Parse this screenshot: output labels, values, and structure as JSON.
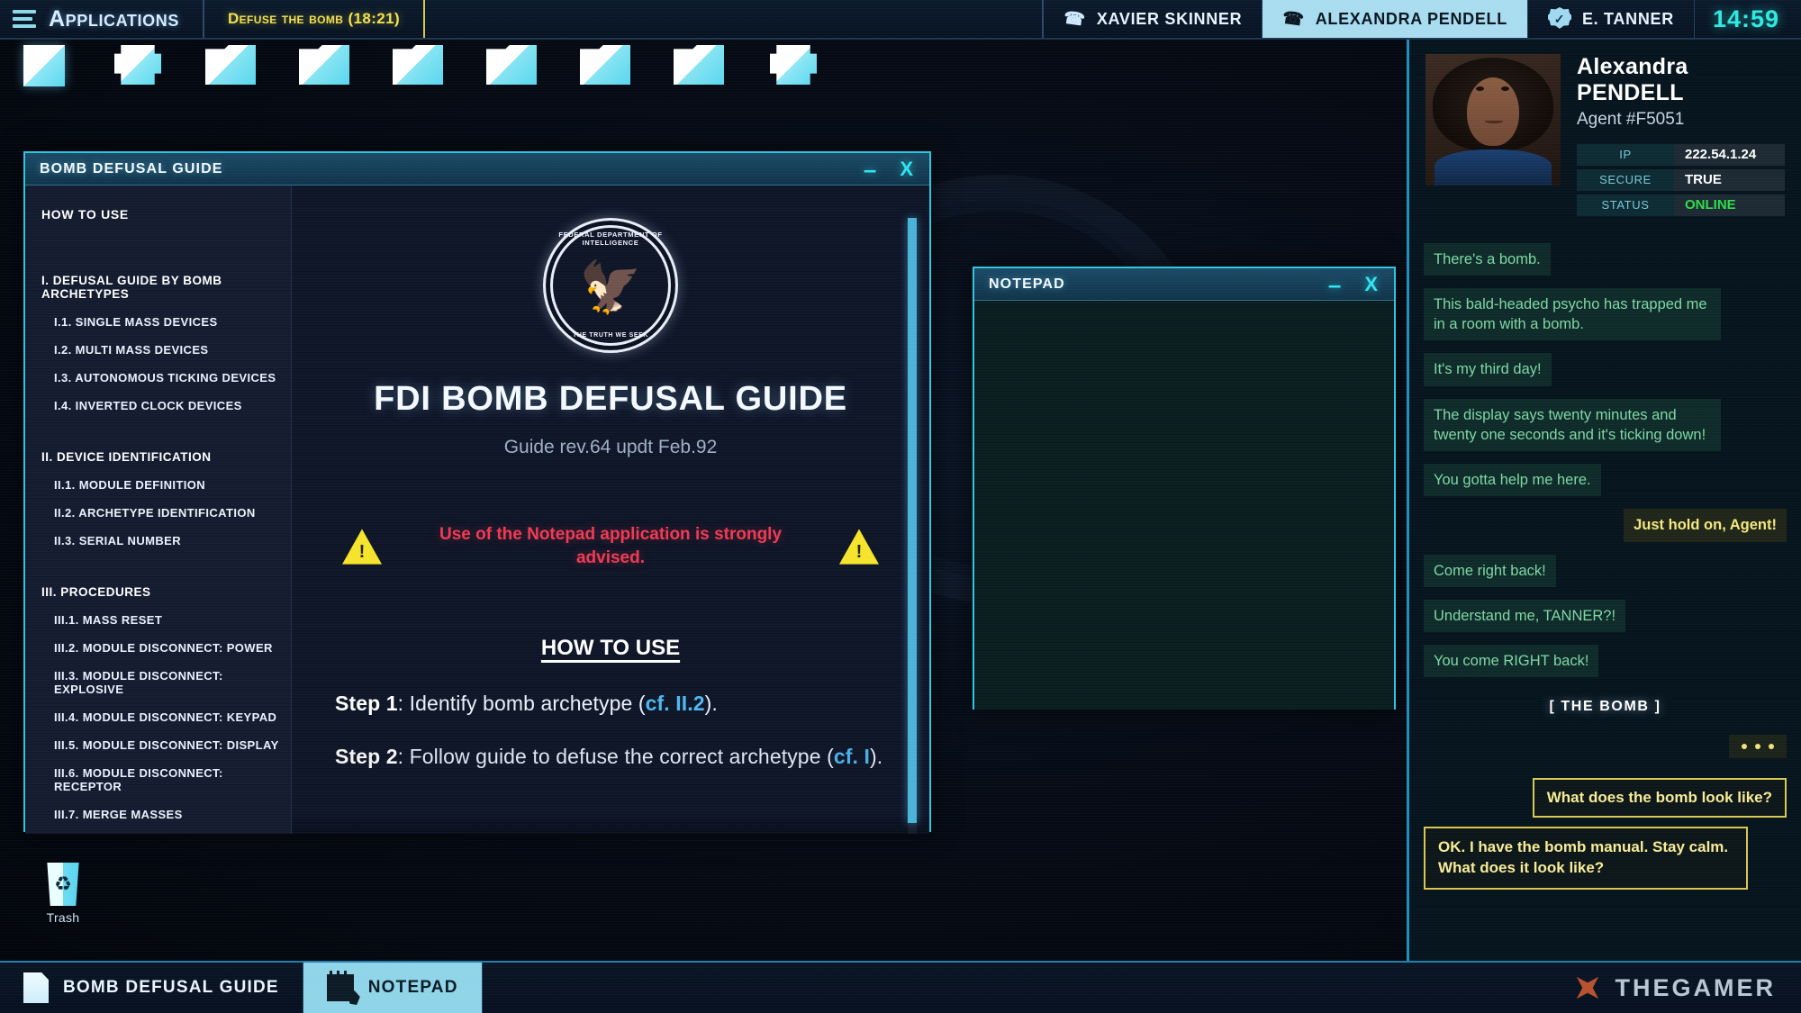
{
  "topbar": {
    "apps_label": "Applications",
    "apps_icon": "hamburger-menu-icon",
    "mission": "Defuse the bomb (18:21)",
    "contacts": [
      {
        "name": "XAVIER SKINNER",
        "icon": "phone-icon",
        "active": false
      },
      {
        "name": "ALEXANDRA PENDELL",
        "icon": "phone-icon",
        "active": true
      }
    ],
    "user": {
      "name": "E. TANNER",
      "icon": "badge-icon"
    },
    "clock": "14:59"
  },
  "desktop": {
    "icons": [
      {
        "name": "document-icon",
        "type": "doc"
      },
      {
        "name": "printer-icon",
        "type": "printer"
      },
      {
        "name": "folder-icon",
        "type": "folder"
      },
      {
        "name": "folder-icon",
        "type": "folder"
      },
      {
        "name": "folder-icon",
        "type": "folder"
      },
      {
        "name": "folder-icon",
        "type": "folder"
      },
      {
        "name": "folder-icon",
        "type": "folder"
      },
      {
        "name": "folder-icon",
        "type": "folder"
      },
      {
        "name": "printer-icon",
        "type": "printer"
      }
    ],
    "trash_label": "Trash",
    "trash_icon": "recycle-icon"
  },
  "guide_window": {
    "title": "BOMB DEFUSAL GUIDE",
    "minimize": "–",
    "close": "X",
    "toc": {
      "how_to_use": "HOW TO USE",
      "sections": [
        {
          "heading": "I. DEFUSAL GUIDE BY BOMB ARCHETYPES",
          "items": [
            "I.1. SINGLE MASS DEVICES",
            "I.2. MULTI MASS DEVICES",
            "I.3. AUTONOMOUS TICKING DEVICES",
            "I.4. INVERTED CLOCK DEVICES"
          ]
        },
        {
          "heading": "II. DEVICE IDENTIFICATION",
          "items": [
            "II.1. MODULE DEFINITION",
            "II.2. ARCHETYPE IDENTIFICATION",
            "II.3. SERIAL NUMBER"
          ]
        },
        {
          "heading": "III. PROCEDURES",
          "items": [
            "III.1. MASS RESET",
            "III.2. MODULE DISCONNECT: POWER",
            "III.3. MODULE DISCONNECT: EXPLOSIVE",
            "III.4. MODULE DISCONNECT: KEYPAD",
            "III.5. MODULE DISCONNECT: DISPLAY",
            "III.6. MODULE DISCONNECT: RECEPTOR",
            "III.7. MERGE MASSES"
          ]
        }
      ]
    },
    "content": {
      "seal_top_text": "FEDERAL DEPARTMENT OF INTELLIGENCE",
      "seal_bottom_text": "THE TRUTH WE SEEK",
      "seal_icon": "eagle-seal-icon",
      "title": "FDI BOMB DEFUSAL GUIDE",
      "revision": "Guide rev.64 updt Feb.92",
      "warning_icon": "warning-triangle-icon",
      "warning_text": "Use of the Notepad application is strongly advised.",
      "how_to_use_heading": "HOW TO USE",
      "step1_label": "Step 1",
      "step1_text": ": Identify bomb archetype (",
      "step1_ref": "cf. II.2",
      "step1_tail": ").",
      "step2_label": "Step 2",
      "step2_text": ": Follow guide to defuse the correct archetype (",
      "step2_ref": "cf. I",
      "step2_tail": ")."
    }
  },
  "notepad_window": {
    "title": "NOTEPAD",
    "minimize": "–",
    "close": "X",
    "content": ""
  },
  "sidebar": {
    "contact": {
      "first_name": "Alexandra",
      "last_name": "PENDELL",
      "agent_id": "Agent #F5051",
      "avatar_name": "contact-avatar"
    },
    "info_rows": [
      {
        "key": "IP",
        "value": "222.54.1.24",
        "state": "normal"
      },
      {
        "key": "SECURE",
        "value": "TRUE",
        "state": "normal"
      },
      {
        "key": "STATUS",
        "value": "ONLINE",
        "state": "online"
      }
    ],
    "messages": [
      {
        "from": "them",
        "text": "There's a bomb."
      },
      {
        "from": "them",
        "text": "This bald-headed psycho has trapped me in a room with a bomb."
      },
      {
        "from": "them",
        "text": "It's my third day!"
      },
      {
        "from": "them",
        "text": "The display says twenty minutes and twenty one seconds and it's ticking down!"
      },
      {
        "from": "them",
        "text": "You gotta help me here."
      },
      {
        "from": "me",
        "text": "Just hold on, Agent!"
      },
      {
        "from": "them",
        "text": "Come right back!"
      },
      {
        "from": "them",
        "text": "Understand me, TANNER?!"
      },
      {
        "from": "them",
        "text": "You come RIGHT back!"
      },
      {
        "from": "system",
        "text": "[   THE BOMB   ]"
      },
      {
        "from": "typing",
        "text": "• • •"
      }
    ],
    "choices": [
      {
        "text": "What does the bomb look like?",
        "align": "right"
      },
      {
        "text": "OK. I have the bomb manual. Stay calm. What does it look like?",
        "align": "left"
      }
    ]
  },
  "taskbar": {
    "items": [
      {
        "label": "BOMB DEFUSAL GUIDE",
        "icon": "document-icon",
        "active": false
      },
      {
        "label": "NOTEPAD",
        "icon": "notepad-icon",
        "active": true
      }
    ],
    "watermark": {
      "text": "THEGAMER",
      "icon": "thegamer-logo-icon"
    }
  },
  "colors": {
    "accent_cyan": "#2ec5e0",
    "mission_yellow": "#f2e14e",
    "online_green": "#2fdc4a",
    "warning_red": "#f03a52",
    "warning_yellow": "#f5e32c"
  }
}
